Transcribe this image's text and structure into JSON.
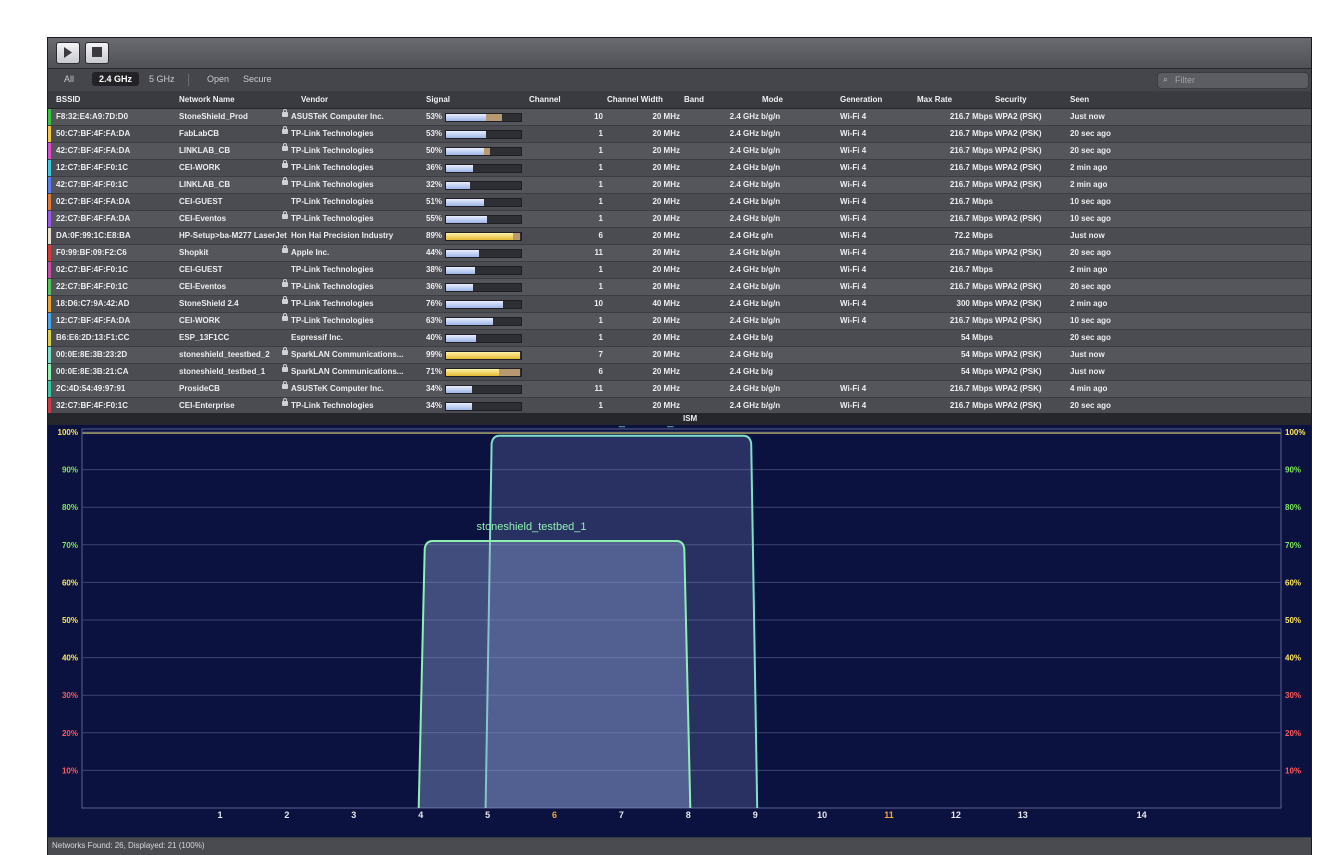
{
  "toolbar": {
    "play_icon": "play-icon",
    "stop_icon": "stop-icon"
  },
  "filter": {
    "tabs": [
      {
        "label": "All",
        "selected": false
      },
      {
        "label": "2.4 GHz",
        "selected": true
      },
      {
        "label": "5 GHz",
        "selected": false
      },
      {
        "label": "Open",
        "selected": false
      },
      {
        "label": "Secure",
        "selected": false
      }
    ],
    "search_placeholder": "Filter"
  },
  "table": {
    "columns": [
      "BSSID",
      "Network Name",
      "Vendor",
      "Signal",
      "Channel",
      "Channel Width",
      "Band",
      "Mode",
      "Generation",
      "Max Rate",
      "Security",
      "Seen"
    ],
    "rows": [
      {
        "bssid": "F8:32:E4:A9:7D:D0",
        "name": "StoneShield_Prod",
        "lock": true,
        "vendor": "ASUSTeK Computer Inc.",
        "signal": "53%",
        "signal_value": 53,
        "peak": 75,
        "hot": false,
        "channel": "10",
        "width": "20 MHz",
        "band": "2.4 GHz",
        "mode": "b/g/n",
        "generation": "Wi-Fi 4",
        "rate": "216.7 Mbps",
        "security": "WPA2 (PSK)",
        "seen": "Just now",
        "strip": "#39c43f"
      },
      {
        "bssid": "50:C7:BF:4F:FA:DA",
        "name": "FabLabCB",
        "lock": true,
        "vendor": "TP-Link Technologies",
        "signal": "53%",
        "signal_value": 53,
        "peak": 0,
        "hot": false,
        "channel": "1",
        "width": "20 MHz",
        "band": "2.4 GHz",
        "mode": "b/g/n",
        "generation": "Wi-Fi 4",
        "rate": "216.7 Mbps",
        "security": "WPA2 (PSK)",
        "seen": "20 sec ago",
        "strip": "#f0c94a"
      },
      {
        "bssid": "42:C7:BF:4F:FA:DA",
        "name": "LINKLAB_CB",
        "lock": true,
        "vendor": "TP-Link Technologies",
        "signal": "50%",
        "signal_value": 50,
        "peak": 58,
        "hot": false,
        "channel": "1",
        "width": "20 MHz",
        "band": "2.4 GHz",
        "mode": "b/g/n",
        "generation": "Wi-Fi 4",
        "rate": "216.7 Mbps",
        "security": "WPA2 (PSK)",
        "seen": "20 sec ago",
        "strip": "#d94fd0"
      },
      {
        "bssid": "12:C7:BF:4F:F0:1C",
        "name": "CEI-WORK",
        "lock": true,
        "vendor": "TP-Link Technologies",
        "signal": "36%",
        "signal_value": 36,
        "peak": 0,
        "hot": false,
        "channel": "1",
        "width": "20 MHz",
        "band": "2.4 GHz",
        "mode": "b/g/n",
        "generation": "Wi-Fi 4",
        "rate": "216.7 Mbps",
        "security": "WPA2 (PSK)",
        "seen": "2 min ago",
        "strip": "#46c6e0"
      },
      {
        "bssid": "42:C7:BF:4F:F0:1C",
        "name": "LINKLAB_CB",
        "lock": true,
        "vendor": "TP-Link Technologies",
        "signal": "32%",
        "signal_value": 32,
        "peak": 0,
        "hot": false,
        "channel": "1",
        "width": "20 MHz",
        "band": "2.4 GHz",
        "mode": "b/g/n",
        "generation": "Wi-Fi 4",
        "rate": "216.7 Mbps",
        "security": "WPA2 (PSK)",
        "seen": "2 min ago",
        "strip": "#5a7df0"
      },
      {
        "bssid": "02:C7:BF:4F:FA:DA",
        "name": "CEI-GUEST",
        "lock": false,
        "vendor": "TP-Link Technologies",
        "signal": "51%",
        "signal_value": 51,
        "peak": 0,
        "hot": false,
        "channel": "1",
        "width": "20 MHz",
        "band": "2.4 GHz",
        "mode": "b/g/n",
        "generation": "Wi-Fi 4",
        "rate": "216.7 Mbps",
        "security": "",
        "seen": "10 sec ago",
        "strip": "#e07a3c"
      },
      {
        "bssid": "22:C7:BF:4F:FA:DA",
        "name": "CEI-Eventos",
        "lock": true,
        "vendor": "TP-Link Technologies",
        "signal": "55%",
        "signal_value": 55,
        "peak": 0,
        "hot": false,
        "channel": "1",
        "width": "20 MHz",
        "band": "2.4 GHz",
        "mode": "b/g/n",
        "generation": "Wi-Fi 4",
        "rate": "216.7 Mbps",
        "security": "WPA2 (PSK)",
        "seen": "10 sec ago",
        "strip": "#9a5ce8"
      },
      {
        "bssid": "DA:0F:99:1C:E8:BA",
        "name": "HP-Setup>ba-M277 LaserJet",
        "lock": false,
        "vendor": "Hon Hai Precision Industry",
        "signal": "89%",
        "signal_value": 89,
        "peak": 98,
        "hot": true,
        "channel": "6",
        "width": "20 MHz",
        "band": "2.4 GHz",
        "mode": "g/n",
        "generation": "Wi-Fi 4",
        "rate": "72.2 Mbps",
        "security": "",
        "seen": "Just now",
        "strip": "#e8e0d0"
      },
      {
        "bssid": "F0:99:BF:09:F2:C6",
        "name": "Shopkit",
        "lock": true,
        "vendor": "Apple Inc.",
        "signal": "44%",
        "signal_value": 44,
        "peak": 0,
        "hot": false,
        "channel": "11",
        "width": "20 MHz",
        "band": "2.4 GHz",
        "mode": "b/g/n",
        "generation": "Wi-Fi 4",
        "rate": "216.7 Mbps",
        "security": "WPA2 (PSK)",
        "seen": "20 sec ago",
        "strip": "#d43a3a"
      },
      {
        "bssid": "02:C7:BF:4F:F0:1C",
        "name": "CEI-GUEST",
        "lock": false,
        "vendor": "TP-Link Technologies",
        "signal": "38%",
        "signal_value": 38,
        "peak": 0,
        "hot": false,
        "channel": "1",
        "width": "20 MHz",
        "band": "2.4 GHz",
        "mode": "b/g/n",
        "generation": "Wi-Fi 4",
        "rate": "216.7 Mbps",
        "security": "",
        "seen": "2 min ago",
        "strip": "#c34fa8"
      },
      {
        "bssid": "22:C7:BF:4F:F0:1C",
        "name": "CEI-Eventos",
        "lock": true,
        "vendor": "TP-Link Technologies",
        "signal": "36%",
        "signal_value": 36,
        "peak": 0,
        "hot": false,
        "channel": "1",
        "width": "20 MHz",
        "band": "2.4 GHz",
        "mode": "b/g/n",
        "generation": "Wi-Fi 4",
        "rate": "216.7 Mbps",
        "security": "WPA2 (PSK)",
        "seen": "20 sec ago",
        "strip": "#57c25a"
      },
      {
        "bssid": "18:D6:C7:9A:42:AD",
        "name": "StoneShield 2.4",
        "lock": true,
        "vendor": "TP-Link Technologies",
        "signal": "76%",
        "signal_value": 76,
        "peak": 0,
        "hot": false,
        "channel": "10",
        "width": "40 MHz",
        "band": "2.4 GHz",
        "mode": "b/g/n",
        "generation": "Wi-Fi 4",
        "rate": "300 Mbps",
        "security": "WPA2 (PSK)",
        "seen": "2 min ago",
        "strip": "#e6a23a"
      },
      {
        "bssid": "12:C7:BF:4F:FA:DA",
        "name": "CEI-WORK",
        "lock": true,
        "vendor": "TP-Link Technologies",
        "signal": "63%",
        "signal_value": 63,
        "peak": 0,
        "hot": false,
        "channel": "1",
        "width": "20 MHz",
        "band": "2.4 GHz",
        "mode": "b/g/n",
        "generation": "Wi-Fi 4",
        "rate": "216.7 Mbps",
        "security": "WPA2 (PSK)",
        "seen": "10 sec ago",
        "strip": "#4ea6e8"
      },
      {
        "bssid": "B6:E6:2D:13:F1:CC",
        "name": "ESP_13F1CC",
        "lock": false,
        "vendor": "Espressif Inc.",
        "signal": "40%",
        "signal_value": 40,
        "peak": 0,
        "hot": false,
        "channel": "1",
        "width": "20 MHz",
        "band": "2.4 GHz",
        "mode": "b/g",
        "generation": "",
        "rate": "54 Mbps",
        "security": "",
        "seen": "20 sec ago",
        "strip": "#d8d24a"
      },
      {
        "bssid": "00:0E:8E:3B:23:2D",
        "name": "stoneshield_teestbed_2",
        "lock": true,
        "vendor": "SparkLAN Communications...",
        "signal": "99%",
        "signal_value": 99,
        "peak": 0,
        "hot": true,
        "channel": "7",
        "width": "20 MHz",
        "band": "2.4 GHz",
        "mode": "b/g",
        "generation": "",
        "rate": "54 Mbps",
        "security": "WPA2 (PSK)",
        "seen": "Just now",
        "strip": "#7ee0c8"
      },
      {
        "bssid": "00:0E:8E:3B:21:CA",
        "name": "stoneshield_testbed_1",
        "lock": true,
        "vendor": "SparkLAN Communications...",
        "signal": "71%",
        "signal_value": 71,
        "peak": 98,
        "hot": true,
        "channel": "6",
        "width": "20 MHz",
        "band": "2.4 GHz",
        "mode": "b/g",
        "generation": "",
        "rate": "54 Mbps",
        "security": "WPA2 (PSK)",
        "seen": "Just now",
        "strip": "#8ef0b0"
      },
      {
        "bssid": "2C:4D:54:49:97:91",
        "name": "ProsideCB",
        "lock": true,
        "vendor": "ASUSTeK Computer Inc.",
        "signal": "34%",
        "signal_value": 34,
        "peak": 0,
        "hot": false,
        "channel": "11",
        "width": "20 MHz",
        "band": "2.4 GHz",
        "mode": "b/g/n",
        "generation": "Wi-Fi 4",
        "rate": "216.7 Mbps",
        "security": "WPA2 (PSK)",
        "seen": "4 min ago",
        "strip": "#3ec4a0"
      },
      {
        "bssid": "32:C7:BF:4F:F0:1C",
        "name": "CEI-Enterprise",
        "lock": true,
        "vendor": "TP-Link Technologies",
        "signal": "34%",
        "signal_value": 34,
        "peak": 0,
        "hot": false,
        "channel": "1",
        "width": "20 MHz",
        "band": "2.4 GHz",
        "mode": "b/g/n",
        "generation": "Wi-Fi 4",
        "rate": "216.7 Mbps",
        "security": "WPA2 (PSK)",
        "seen": "20 sec ago",
        "strip": "#c93a4a"
      }
    ]
  },
  "ism_label": "ISM",
  "chart_data": {
    "type": "area",
    "xlabel": "",
    "ylabel": "",
    "x_ticks": [
      "1",
      "2",
      "3",
      "4",
      "5",
      "6",
      "7",
      "8",
      "9",
      "10",
      "11",
      "12",
      "13",
      "14"
    ],
    "x_tick_colors": [
      "#e8e8ec",
      "#e8e8ec",
      "#e8e8ec",
      "#e8e8ec",
      "#e8e8ec",
      "#f0a830",
      "#e8e8ec",
      "#e8e8ec",
      "#e8e8ec",
      "#e8e8ec",
      "#f0a830",
      "#e8e8ec",
      "#e8e8ec",
      "#e8e8ec"
    ],
    "y_ticks": [
      "100%",
      "90%",
      "80%",
      "70%",
      "60%",
      "50%",
      "40%",
      "30%",
      "20%",
      "10%"
    ],
    "y_tick_values": [
      100,
      90,
      80,
      70,
      60,
      50,
      40,
      30,
      20,
      10
    ],
    "y_tick_colors": [
      "#ffe85a",
      "#7ce85a",
      "#7ce85a",
      "#7ce85a",
      "#ffe85a",
      "#ffe85a",
      "#ffe85a",
      "#ff5a5a",
      "#ff5a5a",
      "#ff5a5a"
    ],
    "ylim": [
      0,
      100
    ],
    "grid": true,
    "series": [
      {
        "name": "stoneshield_teestbed_2",
        "channel_start": 5,
        "channel_end": 9,
        "value": 99,
        "color": "#7ee0c8"
      },
      {
        "name": "stoneshield_testbed_1",
        "channel_start": 4,
        "channel_end": 8,
        "value": 71,
        "color": "#8ef0b0"
      }
    ]
  },
  "status": "Networks Found: 26, Displayed: 21 (100%)"
}
